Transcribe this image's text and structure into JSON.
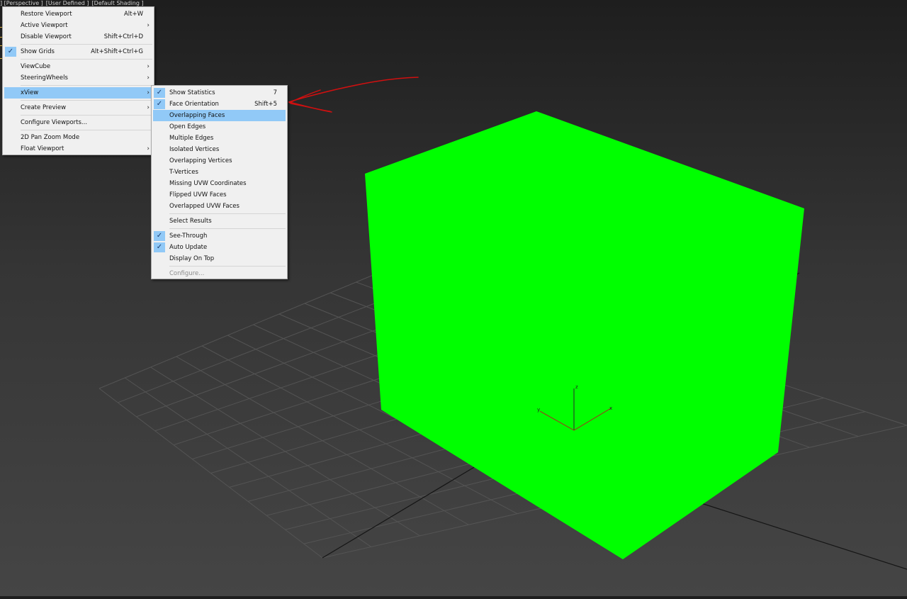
{
  "viewport": {
    "labels": [
      "] [Perspective ]",
      "[User Defined ]",
      "[Default Shading ]"
    ]
  },
  "scene": {
    "box_color": "#00ff00",
    "background_color": "#3a3a3a",
    "axis_labels": {
      "x": "x",
      "y": "y",
      "z": "z"
    }
  },
  "main_menu": {
    "items": [
      {
        "label": "Restore Viewport",
        "shortcut": "Alt+W"
      },
      {
        "label": "Active Viewport",
        "submenu": true
      },
      {
        "label": "Disable Viewport",
        "shortcut": "Shift+Ctrl+D"
      },
      {
        "label": "Show Grids",
        "shortcut": "Alt+Shift+Ctrl+G",
        "checked": true
      },
      {
        "label": "ViewCube",
        "submenu": true
      },
      {
        "label": "SteeringWheels",
        "submenu": true
      },
      {
        "label": "xView",
        "submenu": true,
        "highlighted": true
      },
      {
        "label": "Create Preview",
        "submenu": true
      },
      {
        "label": "Configure Viewports..."
      },
      {
        "label": "2D Pan Zoom Mode"
      },
      {
        "label": "Float Viewport",
        "submenu": true
      }
    ]
  },
  "xview_menu": {
    "items": [
      {
        "label": "Show Statistics",
        "shortcut": "7",
        "checked": true
      },
      {
        "label": "Face Orientation",
        "shortcut": "Shift+5",
        "checked": true
      },
      {
        "label": "Overlapping Faces",
        "highlighted": true
      },
      {
        "label": "Open Edges"
      },
      {
        "label": "Multiple Edges"
      },
      {
        "label": "Isolated Vertices"
      },
      {
        "label": "Overlapping Vertices"
      },
      {
        "label": "T-Vertices"
      },
      {
        "label": "Missing UVW Coordinates"
      },
      {
        "label": "Flipped UVW Faces"
      },
      {
        "label": "Overlapped UVW Faces"
      },
      {
        "label": "Select Results"
      },
      {
        "label": "See-Through",
        "checked": true
      },
      {
        "label": "Auto Update",
        "checked": true
      },
      {
        "label": "Display On Top"
      },
      {
        "label": "Configure...",
        "disabled": true
      }
    ]
  },
  "icons": {
    "checkmark": "checkmark-icon",
    "submenu_arrow": "chevron-right-icon"
  },
  "colors": {
    "menu_highlight": "#91c9f7",
    "annotation_stroke": "#d01010"
  }
}
